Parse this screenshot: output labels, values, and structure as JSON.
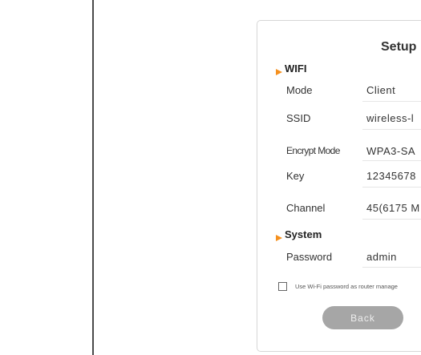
{
  "setup": {
    "title": "Setup",
    "wifi_section": "WIFI",
    "system_section": "System",
    "accent_color": "#f5901e",
    "wifi": {
      "mode_label": "Mode",
      "mode_value": "Client",
      "ssid_label": "SSID",
      "ssid_value": "wireless-l",
      "encrypt_label": "Encrypt Mode",
      "encrypt_value": "WPA3-SA",
      "key_label": "Key",
      "key_value": "12345678",
      "channel_label": "Channel",
      "channel_value": "45(6175 M"
    },
    "system": {
      "password_label": "Password",
      "password_value": "admin"
    },
    "checkbox_label": "Use Wi-Fi password as router manage",
    "checkbox_checked": false,
    "back_label": "Back"
  }
}
